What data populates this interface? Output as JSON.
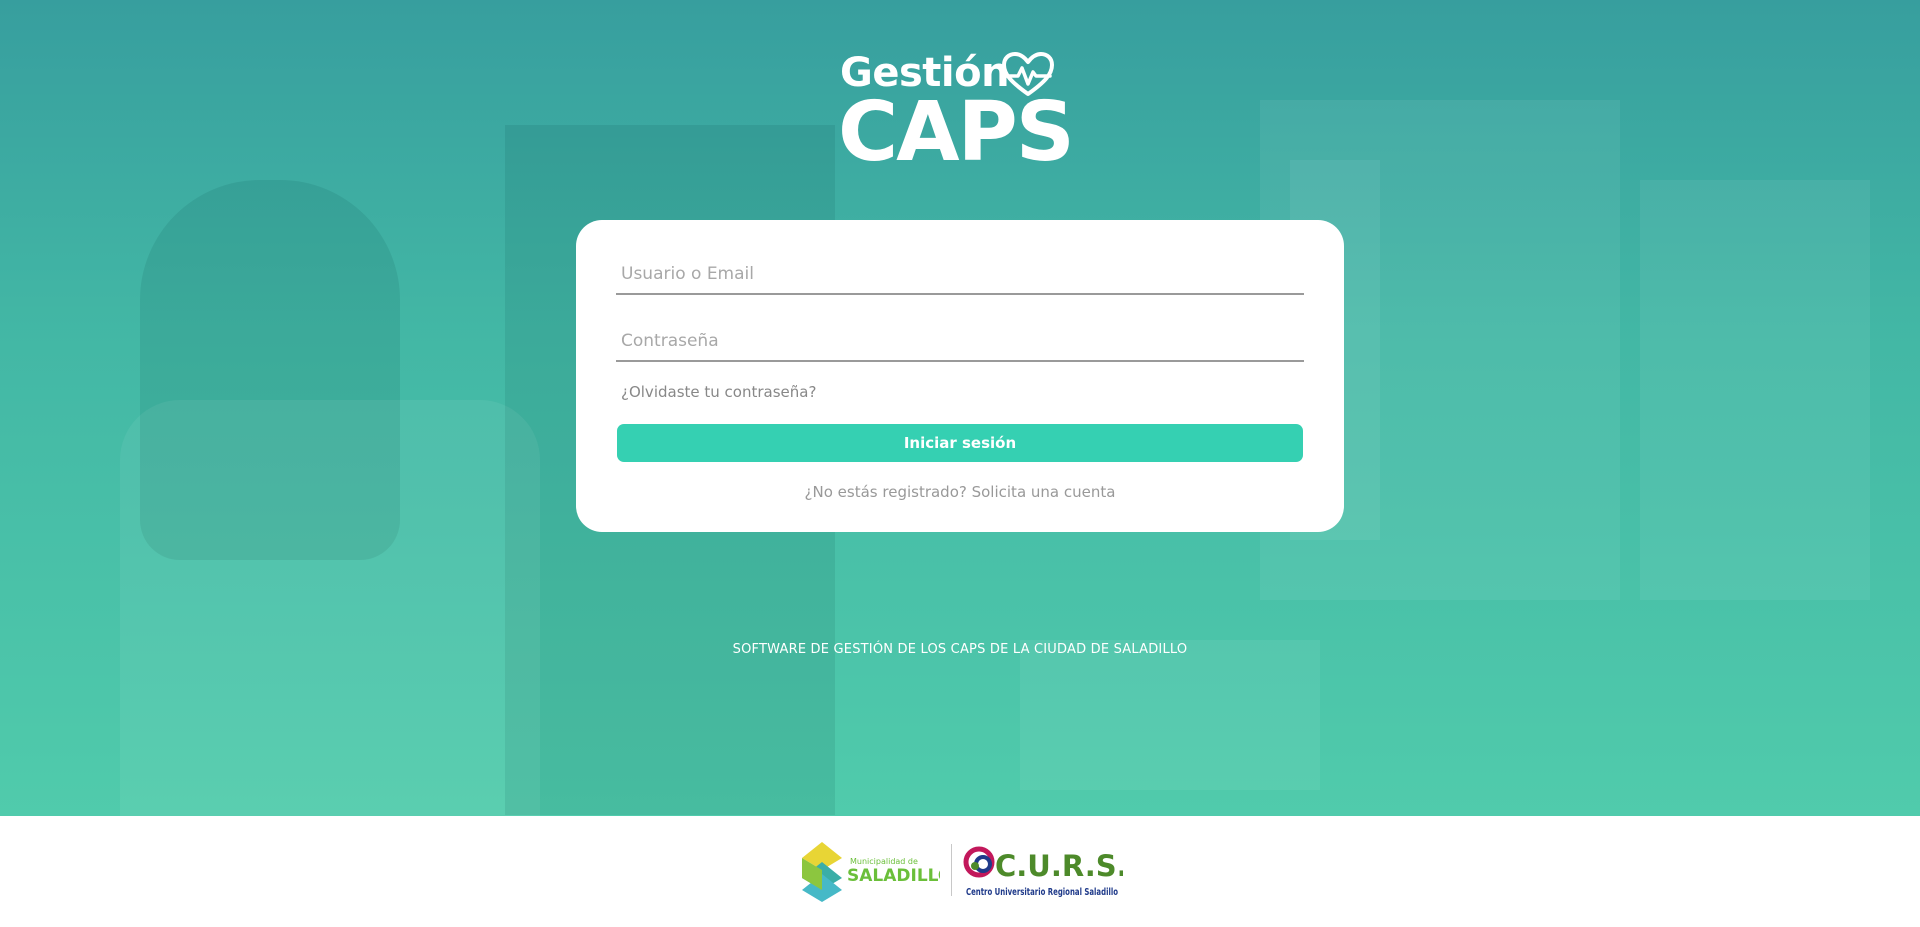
{
  "logo": {
    "top_word": "Gestión",
    "main_word": "CAPS",
    "heart_icon": "heart-pulse-icon"
  },
  "login": {
    "username_placeholder": "Usuario o Email",
    "password_placeholder": "Contraseña",
    "forgot_label": "¿Olvidaste tu contraseña?",
    "submit_label": "Iniciar sesión",
    "register_label": "¿No estás registrado? Solicita una cuenta"
  },
  "tagline": "SOFTWARE DE GESTIÓN DE LOS CAPS DE LA CIUDAD DE SALADILLO",
  "footer": {
    "municipality_small": "Municipalidad de",
    "municipality_name": "SALADILLO",
    "curs_name": "C.U.R.S.",
    "curs_full": "Centro Universitario Regional Saladillo"
  },
  "colors": {
    "accent": "#35d0b2",
    "hero": "#2aa39b",
    "muni_green": "#6bbf3a",
    "curs_green": "#4d8a2a",
    "curs_blue": "#1f3a8a"
  }
}
